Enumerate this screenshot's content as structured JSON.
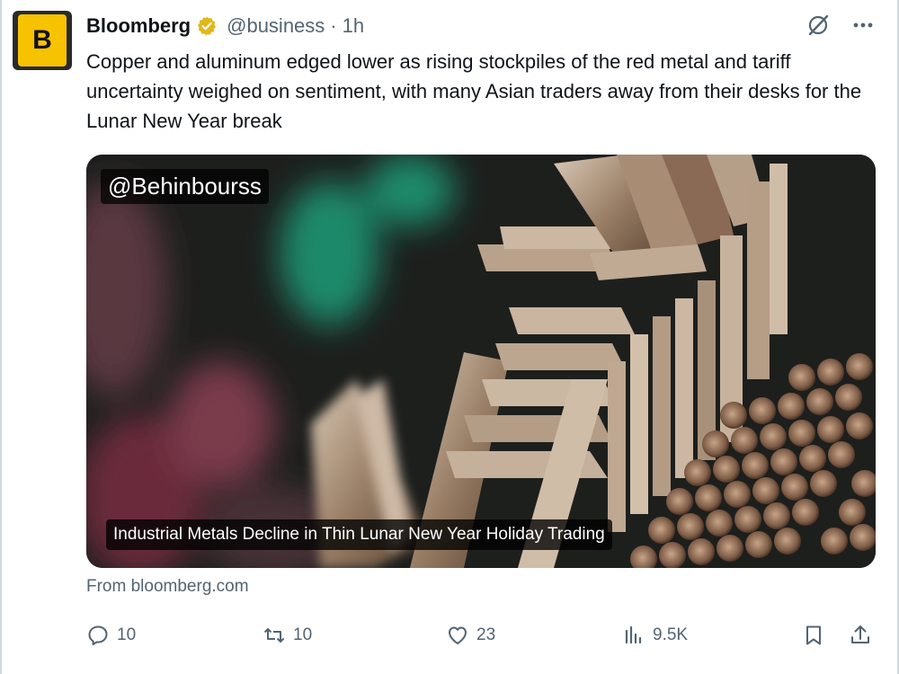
{
  "author": {
    "avatar_letter": "B",
    "name": "Bloomberg",
    "handle": "@business",
    "separator": "·",
    "time": "1h"
  },
  "tweet_text": "Copper and aluminum edged lower as rising stockpiles of the red metal and tariff uncertainty weighed on sentiment, with many Asian traders away from their desks for the Lunar New Year break",
  "media": {
    "watermark": "@Behinbourss",
    "caption": "Industrial Metals Decline in Thin Lunar New Year Holiday Trading"
  },
  "source": "From bloomberg.com",
  "actions": {
    "replies": "10",
    "reposts": "10",
    "likes": "23",
    "views": "9.5K"
  },
  "icons": {
    "verified": "verified-badge-icon",
    "grok": "grok-icon",
    "more": "more-icon",
    "reply": "reply-icon",
    "repost": "repost-icon",
    "like": "heart-icon",
    "views": "views-icon",
    "bookmark": "bookmark-icon",
    "share": "share-icon"
  },
  "colors": {
    "verified_gold": "#e2b719",
    "muted_text": "#536471",
    "avatar_yellow": "#f7c300"
  }
}
